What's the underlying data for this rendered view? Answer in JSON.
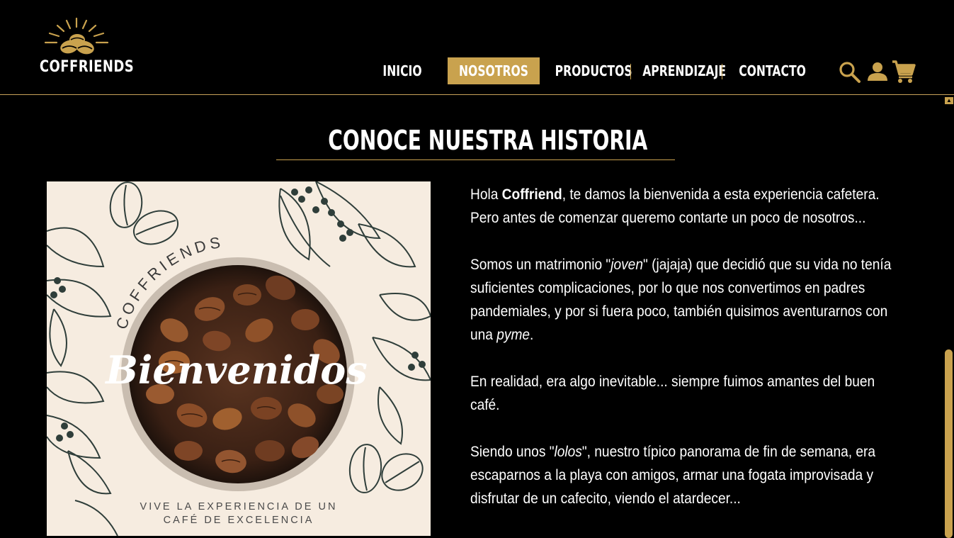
{
  "brand": {
    "name": "COFFRIENDS"
  },
  "nav": {
    "items": [
      {
        "label": "INICIO"
      },
      {
        "label": "NOSOTROS"
      },
      {
        "label": "PRODUCTOS"
      },
      {
        "label": "APRENDIZAJE"
      },
      {
        "label": "CONTACTO"
      }
    ],
    "active": "NOSOTROS"
  },
  "icons": [
    "search-icon",
    "user-icon",
    "cart-icon"
  ],
  "colors": {
    "accent": "#c9a24e",
    "background": "#000000",
    "hero_bg": "#f6ece0"
  },
  "section": {
    "title": "CONOCE NUESTRA HISTORIA"
  },
  "hero": {
    "arc_text": "COFFRIENDS",
    "script_text": "Bienvenidos",
    "caption_line1": "VIVE LA EXPERIENCIA DE UN",
    "caption_line2": "CAFÉ DE EXCELENCIA"
  },
  "story": {
    "p1": {
      "a": "Hola ",
      "b": "Coffriend",
      "c": ", te damos la bienvenida a esta experiencia cafetera. Pero antes de comenzar queremo contarte un poco de nosotros..."
    },
    "p2": {
      "a": "Somos un matrimonio \"",
      "b": "joven",
      "c": "\" (jajaja) que decidió que su vida no tenía suficientes complicaciones, por lo que nos convertimos en padres pandemiales, y por si fuera poco, también quisimos aventurarnos con una ",
      "d": "pyme",
      "e": "."
    },
    "p3": "En realidad, era algo inevitable... siempre fuimos amantes del buen café.",
    "p4": {
      "a": "Siendo unos \"",
      "b": "lolos",
      "c": "\", nuestro típico panorama de fin de semana, era escaparnos a la playa con amigos, armar una fogata improvisada y disfrutar de un cafecito, viendo el atardecer..."
    }
  }
}
